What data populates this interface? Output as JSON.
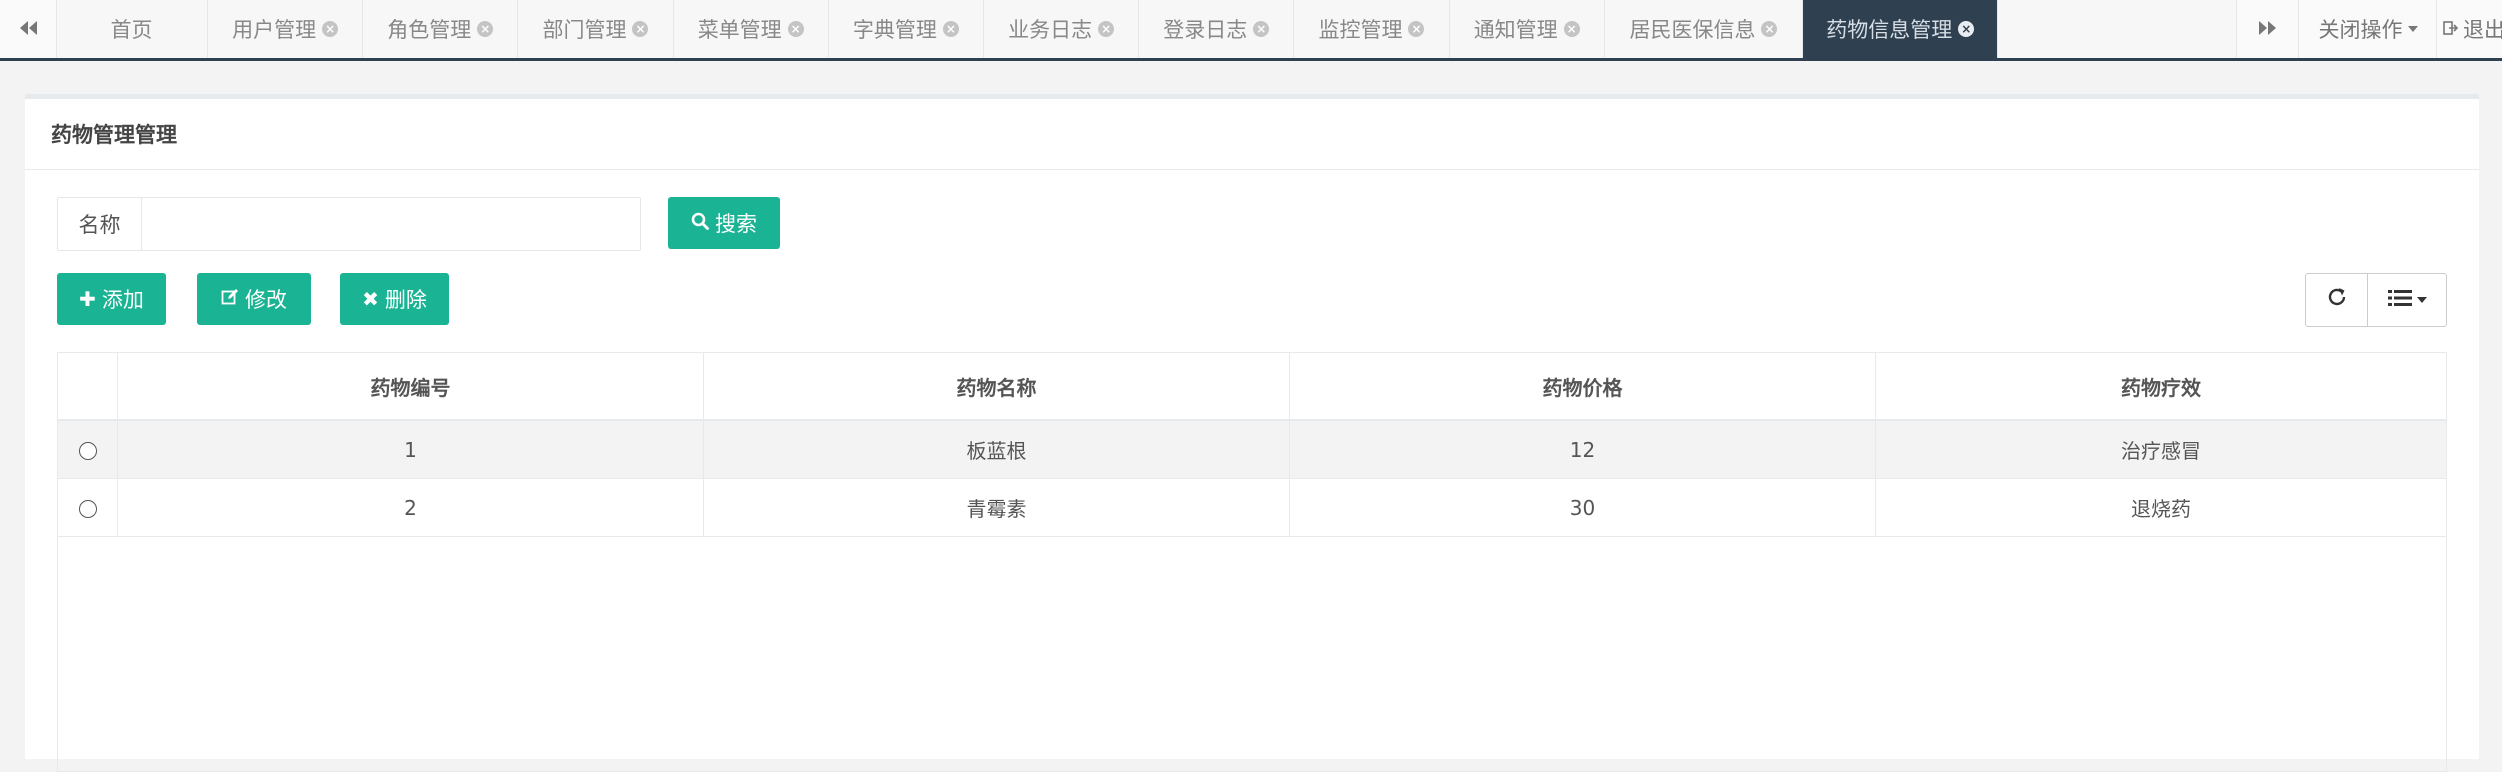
{
  "tabs": [
    {
      "label": "首页",
      "closable": false
    },
    {
      "label": "用户管理",
      "closable": true
    },
    {
      "label": "角色管理",
      "closable": true
    },
    {
      "label": "部门管理",
      "closable": true
    },
    {
      "label": "菜单管理",
      "closable": true
    },
    {
      "label": "字典管理",
      "closable": true
    },
    {
      "label": "业务日志",
      "closable": true
    },
    {
      "label": "登录日志",
      "closable": true
    },
    {
      "label": "监控管理",
      "closable": true
    },
    {
      "label": "通知管理",
      "closable": true
    },
    {
      "label": "居民医保信息",
      "closable": true
    },
    {
      "label": "药物信息管理",
      "closable": true,
      "active": true
    }
  ],
  "toolbar_right": {
    "close_ops_label": "关闭操作",
    "logout_label": "退出"
  },
  "panel": {
    "title": "药物管理管理"
  },
  "search": {
    "field_label": "名称",
    "value": "",
    "button_label": "搜索"
  },
  "actions": {
    "add_label": "添加",
    "edit_label": "修改",
    "delete_label": "删除"
  },
  "table": {
    "columns": [
      "药物编号",
      "药物名称",
      "药物价格",
      "药物疗效"
    ],
    "rows": [
      [
        "1",
        "板蓝根",
        "12",
        "治疗感冒"
      ],
      [
        "2",
        "青霉素",
        "30",
        "退烧药"
      ]
    ]
  },
  "colors": {
    "accent": "#1ab394",
    "active_tab": "#2f4050"
  },
  "icons": {
    "nav_back": "double-left-arrow-icon",
    "nav_forward": "double-right-arrow-icon",
    "search": "search-icon",
    "add": "plus-icon",
    "edit": "edit-icon",
    "delete": "x-icon",
    "refresh": "refresh-icon",
    "columns": "list-icon",
    "logout": "sign-out-icon"
  }
}
